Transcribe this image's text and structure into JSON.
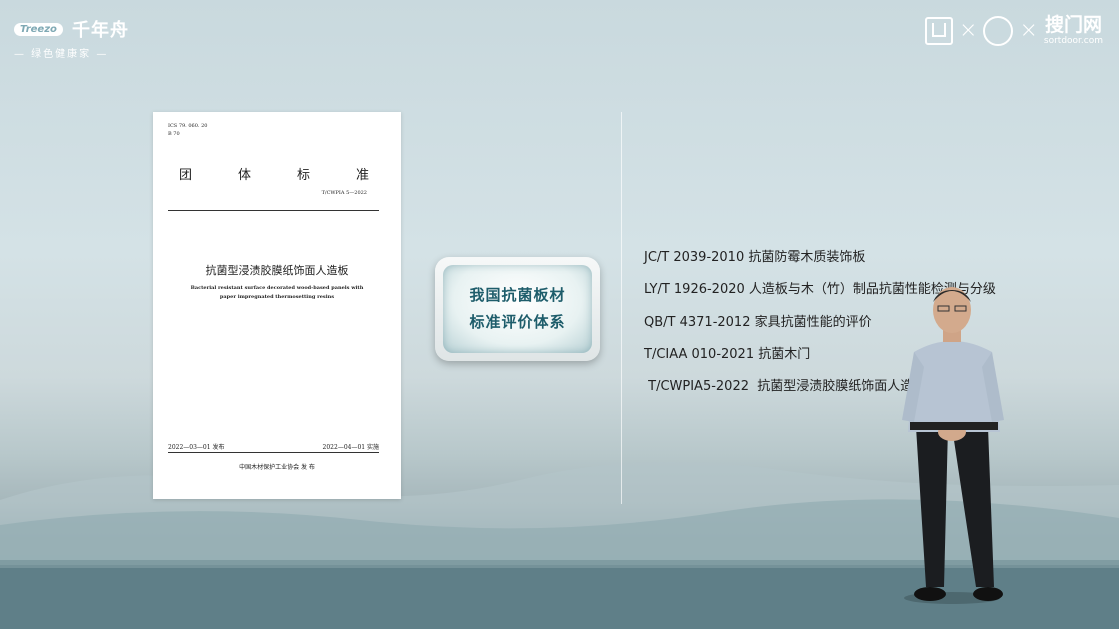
{
  "brand": {
    "logo_text": "Treezo",
    "name": "千年舟",
    "slogan": "— 绿色健康家 —"
  },
  "partners": {
    "separator": "×",
    "site_name": "搜门网",
    "site_url": "sortdoor.com"
  },
  "document": {
    "ics_line1": "ICS 79. 060. 20",
    "ics_line2": "B 70",
    "standard_chars": [
      "团",
      "体",
      "标",
      "准"
    ],
    "code": "T/CWPIA 5—2022",
    "title": "抗菌型浸渍胶膜纸饰面人造板",
    "english_title": "Bacterial resistant surface decorated wood-based panels with paper impregnated thermosetting resins",
    "issue_date": "2022—03—01 发布",
    "effective_date": "2022—04—01 实施",
    "publisher": "中国木材保护工业协会      发 布"
  },
  "center_button": {
    "line1": "我国抗菌板材",
    "line2": "标准评价体系"
  },
  "standards": [
    "JC/T 2039-2010 抗菌防霉木质装饰板",
    "LY/T 1926-2020 人造板与木（竹）制品抗菌性能检测与分级",
    "QB/T 4371-2012 家具抗菌性能的评价",
    "T/CIAA 010-2021 抗菌木门",
    " T/CWPIA5-2022  抗菌型浸渍胶膜纸饰面人造板"
  ],
  "colors": {
    "accent_text": "#1e5d6b",
    "sky": "#d4e2e6",
    "water": "#6d8c94"
  }
}
